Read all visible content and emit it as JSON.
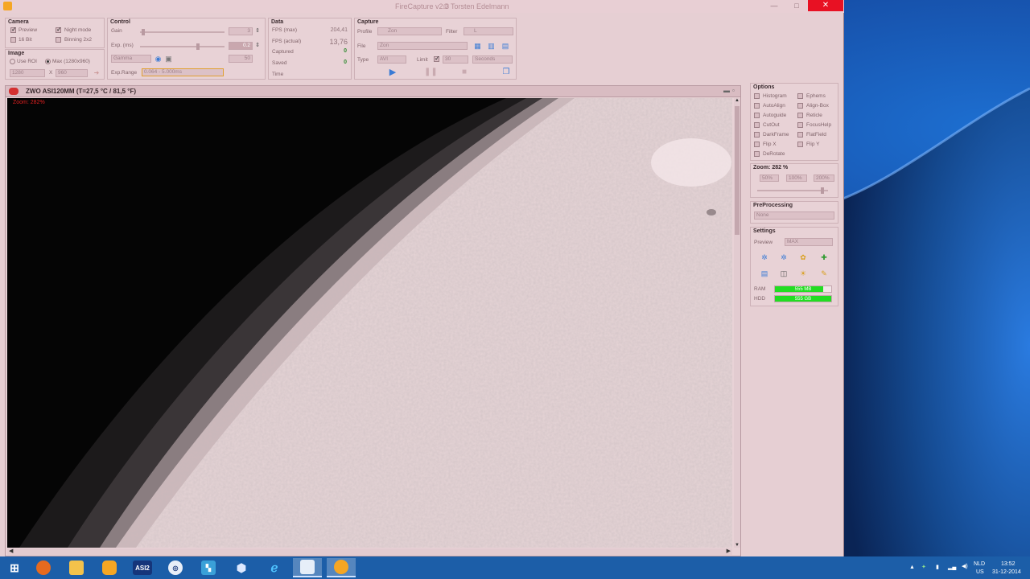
{
  "window": {
    "title": "FireCapture v2.3",
    "author": "© Torsten Edelmann",
    "min": "—",
    "max": "□",
    "close": "✕"
  },
  "camera": {
    "title": "Camera",
    "preview": "Preview",
    "night_mode": "Night mode",
    "bit16": "16 Bit",
    "binning": "Binning 2x2"
  },
  "image": {
    "title": "Image",
    "use_roi": "Use ROI",
    "max_res": "Max (1280x960)",
    "width": "1280",
    "x": "X",
    "height": "960"
  },
  "control": {
    "title": "Control",
    "gain_label": "Gain",
    "gain_value": "3",
    "exp_label": "Exp. (ms)",
    "exp_value": "0.2",
    "gamma_select": "Gamma",
    "gamma_value": "50",
    "exp_range_label": "Exp.Range",
    "exp_range_value": "0.064 - 5.000ms"
  },
  "data": {
    "title": "Data",
    "fps_max_label": "FPS (max)",
    "fps_max_value": "204,41",
    "fps_actual_label": "FPS (actual)",
    "fps_actual_value": "13,76",
    "captured_label": "Captured",
    "captured_value": "0",
    "saved_label": "Saved",
    "saved_value": "0",
    "time_label": "Time"
  },
  "capture": {
    "title": "Capture",
    "profile_label": "Profile",
    "profile_value": "Zon",
    "filter_label": "Filter",
    "filter_value": "L",
    "file_label": "File",
    "file_value": "Zon",
    "type_label": "Type",
    "type_value": "AVI",
    "limit_label": "Limit",
    "limit_value": "30",
    "limit_unit": "Seconds"
  },
  "preview": {
    "camera_title": "ZWO ASI120MM  (T=27,5 °C / 81,5 °F)",
    "zoom_tag": "Zoom: 282%"
  },
  "options": {
    "title": "Options",
    "items_left": [
      "Histogram",
      "AutoAlign",
      "Autoguide",
      "CutOut",
      "DarkFrame",
      "Flip X",
      "DeRotate"
    ],
    "items_right": [
      "Ephems",
      "Align-Box",
      "Reticle",
      "FocusHelp",
      "FlatField",
      "Flip Y"
    ]
  },
  "zoom": {
    "title": "Zoom: 282 %",
    "b50": "50%",
    "b100": "100%",
    "b200": "200%",
    "level_fraction": 0.94
  },
  "preprocessing": {
    "title": "PreProcessing",
    "value": "None"
  },
  "settings": {
    "title": "Settings",
    "preview_label": "Preview",
    "preview_value": "MAX",
    "ram_label": "RAM",
    "ram_value": "555 MB",
    "hdd_label": "HDD",
    "hdd_value": "555 GB",
    "ram_fraction": 0.85,
    "hdd_fraction": 1.0
  },
  "taskbar": {
    "lang1": "NLD",
    "lang2": "US",
    "time": "13:52",
    "date": "31-12-2014",
    "asi_label": "ASI2",
    "items": [
      "start",
      "firefox",
      "explorer",
      "firecapture-yellow",
      "asi",
      "vpn",
      "tool",
      "3d-app",
      "ie",
      "window",
      "sun-app"
    ]
  },
  "colors": {
    "accent": "#2e8a2e",
    "close_red": "#e81123",
    "bar_green": "#22dd22",
    "taskbar": "#1c5ea8"
  }
}
